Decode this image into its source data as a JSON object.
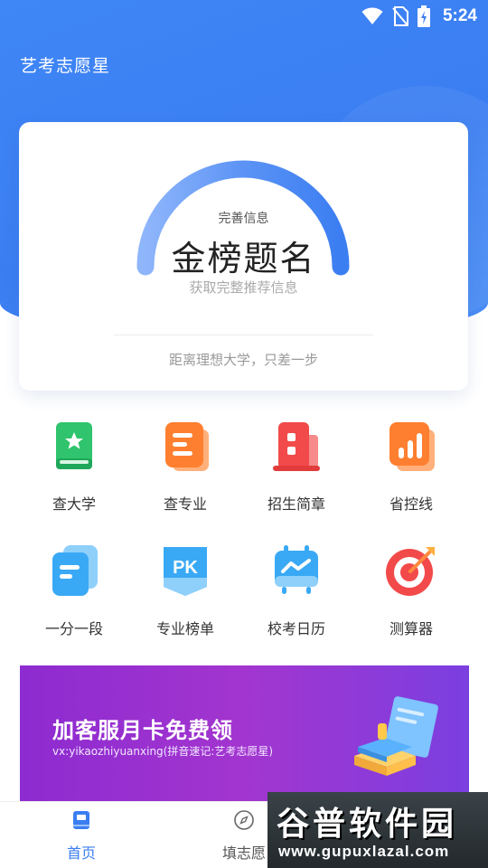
{
  "status_bar": {
    "time": "5:24",
    "icons": [
      "wifi-icon",
      "no-sim-icon",
      "battery-charging-icon"
    ]
  },
  "app_title": "艺考志愿星",
  "score_card": {
    "gauge_subtitle": "完善信息",
    "gauge_title": "金榜题名",
    "gauge_hint": "获取完整推荐信息",
    "footer": "距离理想大学，只差一步"
  },
  "features": [
    {
      "label": "查大学",
      "icon": "book-star-icon",
      "color": "#2fc46d"
    },
    {
      "label": "查专业",
      "icon": "document-lines-icon",
      "color": "#ff8a3d"
    },
    {
      "label": "招生简章",
      "icon": "building-icon",
      "color": "#f24a4a"
    },
    {
      "label": "省控线",
      "icon": "bar-chart-icon",
      "color": "#ff8a3d"
    },
    {
      "label": "一分一段",
      "icon": "stacked-cards-icon",
      "color": "#3aa9f5"
    },
    {
      "label": "专业榜单",
      "icon": "pk-badge-icon",
      "color": "#3aa9f5"
    },
    {
      "label": "校考日历",
      "icon": "calendar-board-icon",
      "color": "#3aa9f5"
    },
    {
      "label": "测算器",
      "icon": "target-icon",
      "color": "#f24a4a"
    }
  ],
  "banner": {
    "title": "加客服月卡免费领",
    "subtitle": "vx:yikaozhiyuanxing(拼音速记:艺考志愿星)"
  },
  "tabs": [
    {
      "label": "首页",
      "icon": "home-book-icon",
      "active": true
    },
    {
      "label": "填志愿",
      "icon": "compass-icon",
      "active": false
    }
  ],
  "watermark": {
    "text": "谷普软件园",
    "url": "www.gupuxlazal.com"
  },
  "colors": {
    "accent": "#3b7ef2",
    "tab_active": "#3b7ef2",
    "tab_inactive": "#555555"
  }
}
